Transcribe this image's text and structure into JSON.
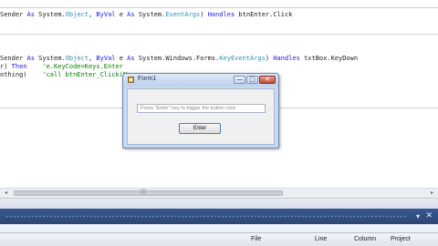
{
  "code": {
    "line1": {
      "p1": "Sender ",
      "k1": "As ",
      "t1": "System.",
      "c1": "Object",
      "p2": ", ",
      "k2": "ByVal",
      "p3": " e ",
      "k3": "As ",
      "t2": "System.",
      "c2": "EventArgs",
      "p4": ") ",
      "k4": "Handles",
      "p5": " btnEnter.Click"
    },
    "line2": {
      "p1": "Sender ",
      "k1": "As ",
      "t1": "System.",
      "c1": "Object",
      "p2": ", ",
      "k2": "ByVal",
      "p3": " e ",
      "k3": "As ",
      "t2": "System.Windows.Forms.",
      "c2": "KeyEventArgs",
      "p4": ") ",
      "k4": "Handles",
      "p5": " txtBox.KeyDown"
    },
    "line3": {
      "p1": "r) ",
      "k1": "Then",
      "p2": "    ",
      "cm": "'e.KeyCode=Keys.Enter"
    },
    "line4": {
      "p1": "othing)",
      "p2": "    ",
      "cm": "'call btnEnter_Click(N"
    }
  },
  "form": {
    "title": "Form1",
    "textbox_placeholder": "Press \"Enter\" key to trigger the button click",
    "button_label": "Enter",
    "minimize_glyph": "—",
    "maximize_glyph": "□",
    "close_glyph": "✕"
  },
  "scrollbar": {
    "left_arrow": "◂",
    "right_arrow": "▸",
    "grip": "|||"
  },
  "panel": {
    "pin_glyph": "▾",
    "close_glyph": "✕"
  },
  "status": {
    "file": "File",
    "line": "Line",
    "column": "Column",
    "project": "Project"
  }
}
